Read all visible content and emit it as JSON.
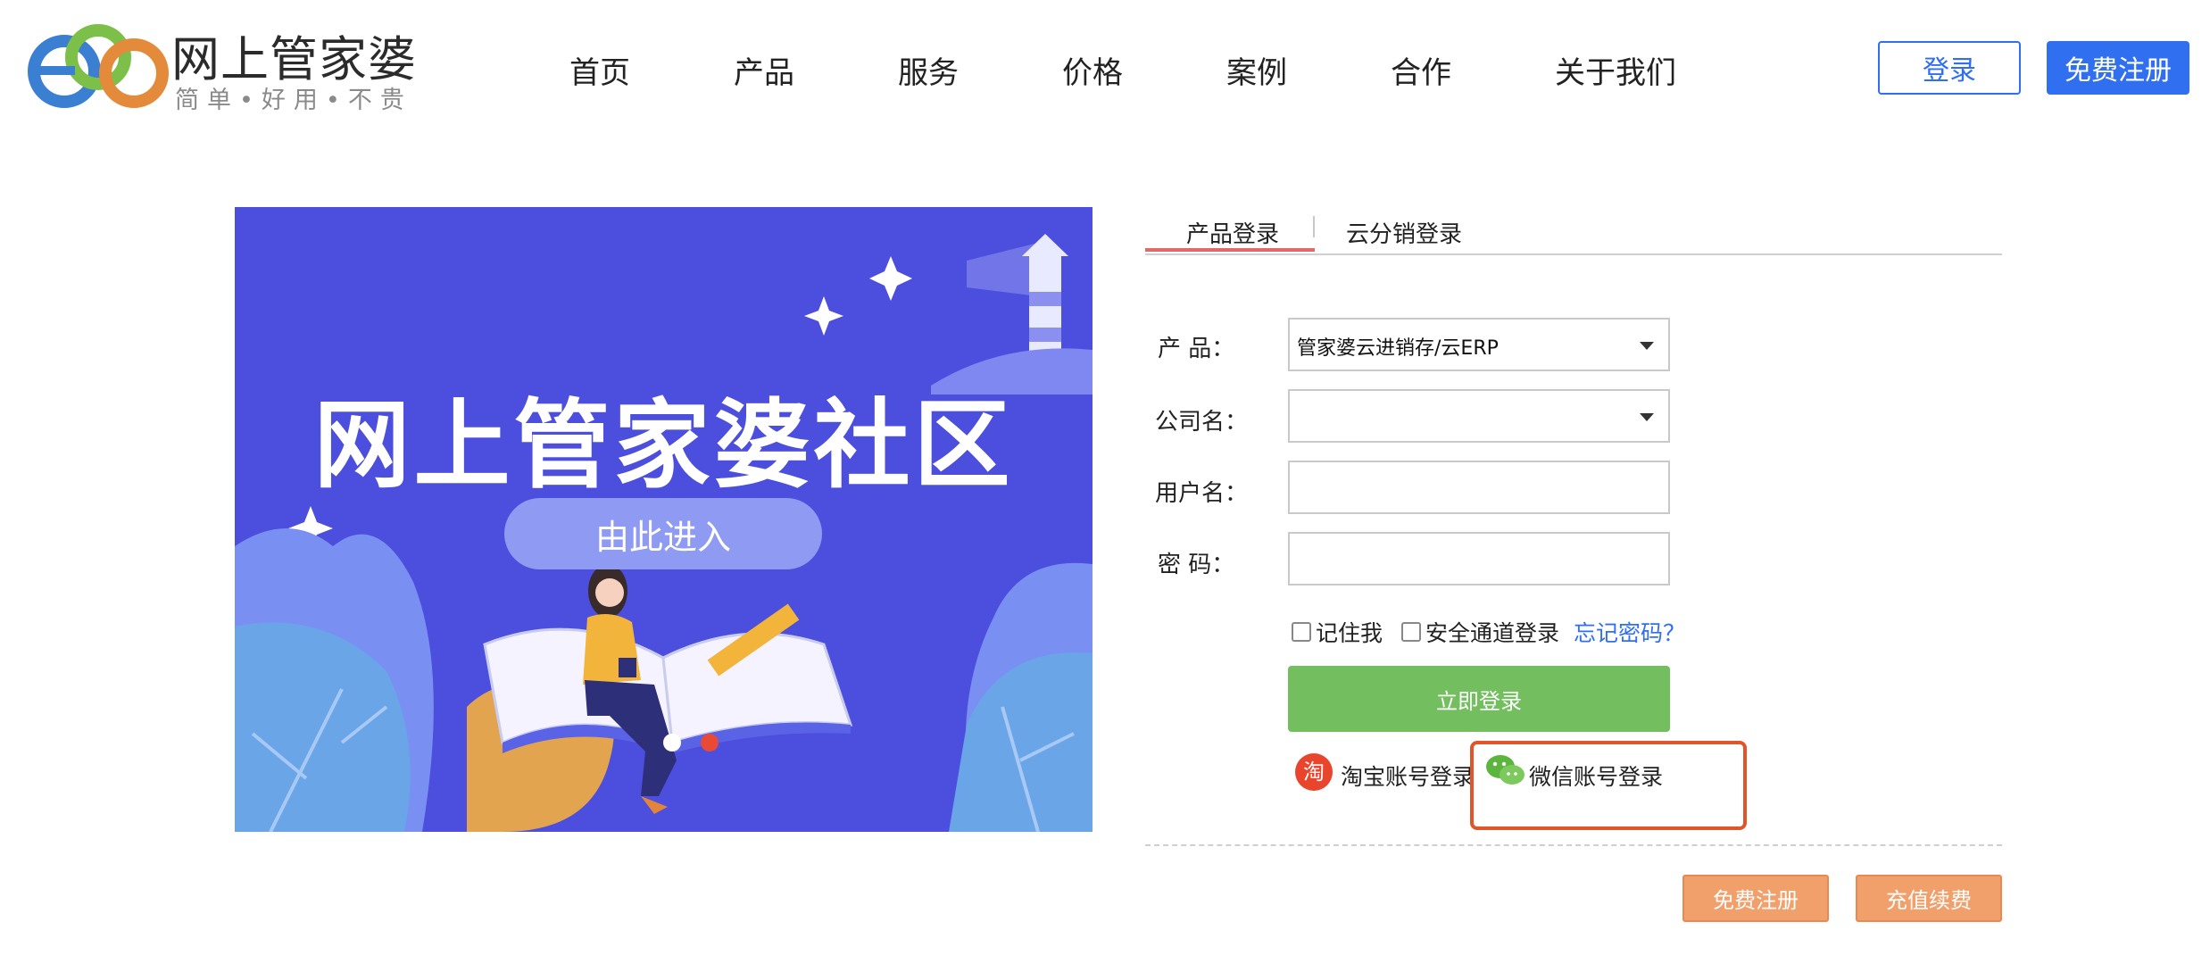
{
  "colors": {
    "brand_blue": "#2f6ff0",
    "banner_bg": "#4c4fdd",
    "submit_green": "#73bf5f",
    "orange_button": "#f2a06b",
    "highlight_red": "#e0562a",
    "tab_accent": "#e06a6a"
  },
  "header": {
    "logo_name": "网上管家婆",
    "logo_slogan": "简单•好用•不贵",
    "nav": [
      "首页",
      "产品",
      "服务",
      "价格",
      "案例",
      "合作",
      "关于我们"
    ],
    "login_label": "登录",
    "register_label": "免费注册"
  },
  "banner": {
    "title": "网上管家婆社区",
    "cta": "由此进入",
    "slides_total": 2,
    "active_slide": 1
  },
  "login": {
    "tabs": [
      "产品登录",
      "云分销登录"
    ],
    "active_tab": 0,
    "fields": {
      "product_label": "产  品：",
      "product_value": "管家婆云进销存/云ERP",
      "company_label": "公司名：",
      "company_value": "",
      "username_label": "用户名：",
      "username_value": "",
      "password_label": "密  码：",
      "password_value": ""
    },
    "remember_label": "记住我",
    "secure_label": "安全通道登录",
    "forgot_label": "忘记密码？",
    "submit_label": "立即登录",
    "taobao_icon_text": "淘",
    "taobao_label": "淘宝账号登录",
    "wechat_label": "微信账号登录",
    "icons": {
      "taobao": "taobao-icon",
      "wechat": "wechat-icon"
    }
  },
  "footer_buttons": {
    "register": "免费注册",
    "recharge": "充值续费"
  }
}
